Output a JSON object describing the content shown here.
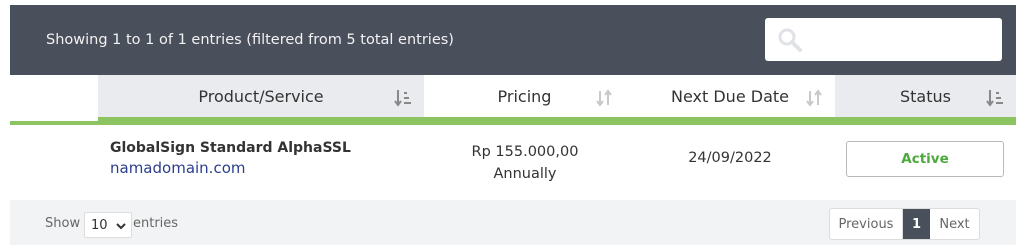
{
  "table_info": "Showing 1 to 1 of 1 entries (filtered from 5 total entries)",
  "search": {
    "value": "",
    "placeholder": ""
  },
  "columns": [
    {
      "label": "Product/Service"
    },
    {
      "label": "Pricing"
    },
    {
      "label": "Next Due Date"
    },
    {
      "label": "Status"
    }
  ],
  "rows": [
    {
      "product": "GlobalSign Standard AlphaSSL",
      "domain": "namadomain.com",
      "price": "Rp 155.000,00",
      "cycle": "Annually",
      "due_date": "24/09/2022",
      "status": "Active"
    }
  ],
  "footer": {
    "show_label": "Show",
    "page_size": "10",
    "entries_label": "entries"
  },
  "pagination": {
    "previous": "Previous",
    "current": "1",
    "next": "Next"
  },
  "colors": {
    "header_bar": "#4a4f5c",
    "accent_green": "#8cc462",
    "status_green": "#4caa3c",
    "link_blue": "#2c3e8c"
  }
}
